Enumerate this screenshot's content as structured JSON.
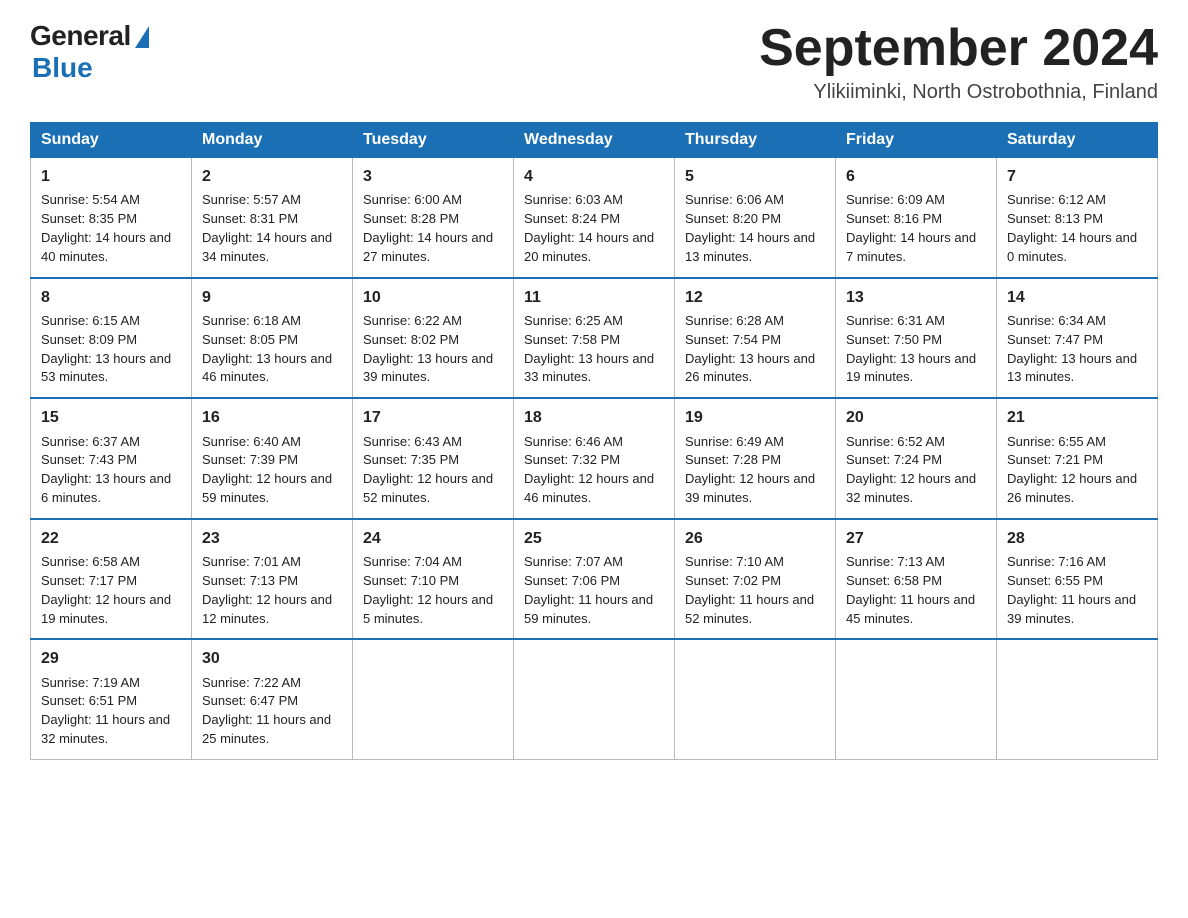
{
  "header": {
    "logo_general": "General",
    "logo_blue": "Blue",
    "month_title": "September 2024",
    "location": "Ylikiiminki, North Ostrobothnia, Finland"
  },
  "columns": [
    "Sunday",
    "Monday",
    "Tuesday",
    "Wednesday",
    "Thursday",
    "Friday",
    "Saturday"
  ],
  "weeks": [
    [
      {
        "day": "1",
        "sunrise": "5:54 AM",
        "sunset": "8:35 PM",
        "daylight": "14 hours and 40 minutes."
      },
      {
        "day": "2",
        "sunrise": "5:57 AM",
        "sunset": "8:31 PM",
        "daylight": "14 hours and 34 minutes."
      },
      {
        "day": "3",
        "sunrise": "6:00 AM",
        "sunset": "8:28 PM",
        "daylight": "14 hours and 27 minutes."
      },
      {
        "day": "4",
        "sunrise": "6:03 AM",
        "sunset": "8:24 PM",
        "daylight": "14 hours and 20 minutes."
      },
      {
        "day": "5",
        "sunrise": "6:06 AM",
        "sunset": "8:20 PM",
        "daylight": "14 hours and 13 minutes."
      },
      {
        "day": "6",
        "sunrise": "6:09 AM",
        "sunset": "8:16 PM",
        "daylight": "14 hours and 7 minutes."
      },
      {
        "day": "7",
        "sunrise": "6:12 AM",
        "sunset": "8:13 PM",
        "daylight": "14 hours and 0 minutes."
      }
    ],
    [
      {
        "day": "8",
        "sunrise": "6:15 AM",
        "sunset": "8:09 PM",
        "daylight": "13 hours and 53 minutes."
      },
      {
        "day": "9",
        "sunrise": "6:18 AM",
        "sunset": "8:05 PM",
        "daylight": "13 hours and 46 minutes."
      },
      {
        "day": "10",
        "sunrise": "6:22 AM",
        "sunset": "8:02 PM",
        "daylight": "13 hours and 39 minutes."
      },
      {
        "day": "11",
        "sunrise": "6:25 AM",
        "sunset": "7:58 PM",
        "daylight": "13 hours and 33 minutes."
      },
      {
        "day": "12",
        "sunrise": "6:28 AM",
        "sunset": "7:54 PM",
        "daylight": "13 hours and 26 minutes."
      },
      {
        "day": "13",
        "sunrise": "6:31 AM",
        "sunset": "7:50 PM",
        "daylight": "13 hours and 19 minutes."
      },
      {
        "day": "14",
        "sunrise": "6:34 AM",
        "sunset": "7:47 PM",
        "daylight": "13 hours and 13 minutes."
      }
    ],
    [
      {
        "day": "15",
        "sunrise": "6:37 AM",
        "sunset": "7:43 PM",
        "daylight": "13 hours and 6 minutes."
      },
      {
        "day": "16",
        "sunrise": "6:40 AM",
        "sunset": "7:39 PM",
        "daylight": "12 hours and 59 minutes."
      },
      {
        "day": "17",
        "sunrise": "6:43 AM",
        "sunset": "7:35 PM",
        "daylight": "12 hours and 52 minutes."
      },
      {
        "day": "18",
        "sunrise": "6:46 AM",
        "sunset": "7:32 PM",
        "daylight": "12 hours and 46 minutes."
      },
      {
        "day": "19",
        "sunrise": "6:49 AM",
        "sunset": "7:28 PM",
        "daylight": "12 hours and 39 minutes."
      },
      {
        "day": "20",
        "sunrise": "6:52 AM",
        "sunset": "7:24 PM",
        "daylight": "12 hours and 32 minutes."
      },
      {
        "day": "21",
        "sunrise": "6:55 AM",
        "sunset": "7:21 PM",
        "daylight": "12 hours and 26 minutes."
      }
    ],
    [
      {
        "day": "22",
        "sunrise": "6:58 AM",
        "sunset": "7:17 PM",
        "daylight": "12 hours and 19 minutes."
      },
      {
        "day": "23",
        "sunrise": "7:01 AM",
        "sunset": "7:13 PM",
        "daylight": "12 hours and 12 minutes."
      },
      {
        "day": "24",
        "sunrise": "7:04 AM",
        "sunset": "7:10 PM",
        "daylight": "12 hours and 5 minutes."
      },
      {
        "day": "25",
        "sunrise": "7:07 AM",
        "sunset": "7:06 PM",
        "daylight": "11 hours and 59 minutes."
      },
      {
        "day": "26",
        "sunrise": "7:10 AM",
        "sunset": "7:02 PM",
        "daylight": "11 hours and 52 minutes."
      },
      {
        "day": "27",
        "sunrise": "7:13 AM",
        "sunset": "6:58 PM",
        "daylight": "11 hours and 45 minutes."
      },
      {
        "day": "28",
        "sunrise": "7:16 AM",
        "sunset": "6:55 PM",
        "daylight": "11 hours and 39 minutes."
      }
    ],
    [
      {
        "day": "29",
        "sunrise": "7:19 AM",
        "sunset": "6:51 PM",
        "daylight": "11 hours and 32 minutes."
      },
      {
        "day": "30",
        "sunrise": "7:22 AM",
        "sunset": "6:47 PM",
        "daylight": "11 hours and 25 minutes."
      },
      null,
      null,
      null,
      null,
      null
    ]
  ],
  "labels": {
    "sunrise": "Sunrise:",
    "sunset": "Sunset:",
    "daylight": "Daylight:"
  }
}
